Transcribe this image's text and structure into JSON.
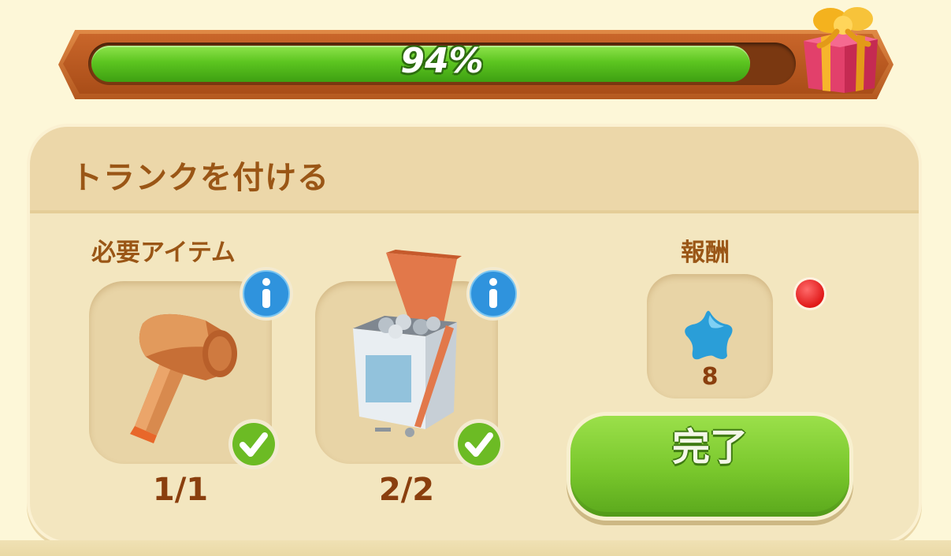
{
  "progress": {
    "percent": 94,
    "label": "94%"
  },
  "task": {
    "title": "トランクを付ける",
    "required_label": "必要アイテム",
    "reward_label": "報酬",
    "items": [
      {
        "icon": "mallet-icon",
        "count": "1/1",
        "completed": true
      },
      {
        "icon": "box-of-screws-icon",
        "count": "2/2",
        "completed": true
      }
    ],
    "reward": {
      "icon": "blue-star-icon",
      "amount": "8"
    },
    "complete_button": "完了"
  },
  "colors": {
    "progress_fill": "#5cc520",
    "title_text": "#9a5616",
    "count_text": "#8a3f0e",
    "button_green": "#79c72c",
    "info_blue": "#2f93dd",
    "star_blue": "#2a9ed8",
    "notification_red": "#e01818"
  }
}
